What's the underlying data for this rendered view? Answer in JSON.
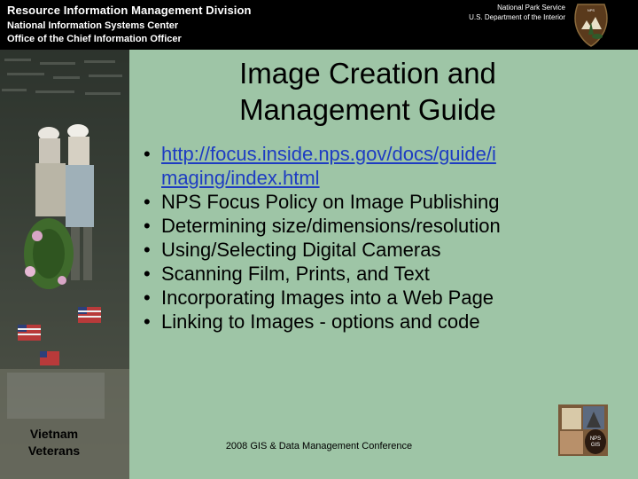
{
  "header": {
    "division": "Resource Information Management Division",
    "center": "National Information Systems Center",
    "office": "Office of the Chief Information Officer",
    "agency": "National Park Service",
    "department": "U.S. Department of the Interior"
  },
  "photo": {
    "caption_line1": "Vietnam",
    "caption_line2": "Veterans"
  },
  "slide": {
    "title_line1": "Image Creation and",
    "title_line2": "Management Guide",
    "link_line1": "http://focus.inside.nps.gov/docs/guide/i",
    "link_line2": "maging/index.html",
    "bullets": [
      "NPS Focus Policy on Image Publishing",
      "Determining size/dimensions/resolution",
      "Using/Selecting Digital Cameras",
      "Scanning Film, Prints, and Text",
      "Incorporating Images into a Web Page",
      "Linking to Images - options and code"
    ]
  },
  "footer": {
    "conference": "2008 GIS & Data Management Conference"
  },
  "colors": {
    "background": "#9ec5a6",
    "header": "#000000",
    "link": "#1e3cc2"
  },
  "icons": {
    "logo": "nps-arrowhead-icon",
    "thumbnail": "nps-gis-thumbnail"
  }
}
